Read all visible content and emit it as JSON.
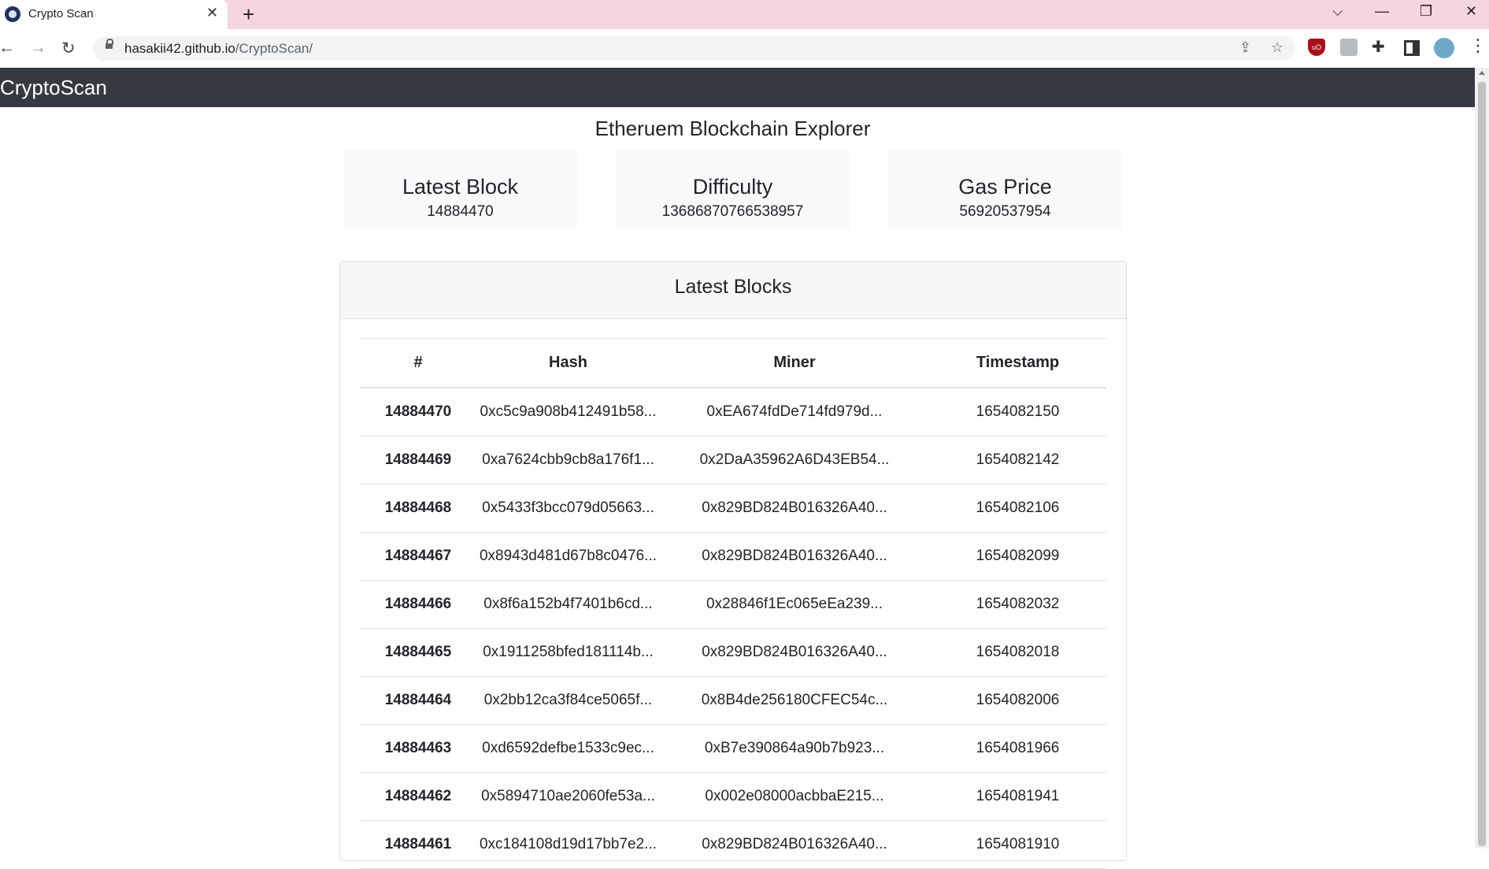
{
  "browser": {
    "tab_title": "Crypto Scan",
    "url_host": "hasakii42.github.io",
    "url_path": "/CryptoScan/"
  },
  "navbar": {
    "brand": "CryptoScan"
  },
  "page": {
    "title": "Etheruem Blockchain Explorer"
  },
  "stats": [
    {
      "label": "Latest Block",
      "value": "14884470"
    },
    {
      "label": "Difficulty",
      "value": "13686870766538957"
    },
    {
      "label": "Gas Price",
      "value": "56920537954"
    }
  ],
  "blocks": {
    "title": "Latest Blocks",
    "columns": [
      "#",
      "Hash",
      "Miner",
      "Timestamp"
    ],
    "rows": [
      {
        "number": "14884470",
        "hash": "0xc5c9a908b412491b58...",
        "miner": "0xEA674fdDe714fd979d...",
        "timestamp": "1654082150"
      },
      {
        "number": "14884469",
        "hash": "0xa7624cbb9cb8a176f1...",
        "miner": "0x2DaA35962A6D43EB54...",
        "timestamp": "1654082142"
      },
      {
        "number": "14884468",
        "hash": "0x5433f3bcc079d05663...",
        "miner": "0x829BD824B016326A40...",
        "timestamp": "1654082106"
      },
      {
        "number": "14884467",
        "hash": "0x8943d481d67b8c0476...",
        "miner": "0x829BD824B016326A40...",
        "timestamp": "1654082099"
      },
      {
        "number": "14884466",
        "hash": "0x8f6a152b4f7401b6cd...",
        "miner": "0x28846f1Ec065eEa239...",
        "timestamp": "1654082032"
      },
      {
        "number": "14884465",
        "hash": "0x1911258bfed181114b...",
        "miner": "0x829BD824B016326A40...",
        "timestamp": "1654082018"
      },
      {
        "number": "14884464",
        "hash": "0x2bb12ca3f84ce5065f...",
        "miner": "0x8B4de256180CFEC54c...",
        "timestamp": "1654082006"
      },
      {
        "number": "14884463",
        "hash": "0xd6592defbe1533c9ec...",
        "miner": "0xB7e390864a90b7b923...",
        "timestamp": "1654081966"
      },
      {
        "number": "14884462",
        "hash": "0x5894710ae2060fe53a...",
        "miner": "0x002e08000acbbaE215...",
        "timestamp": "1654081941"
      },
      {
        "number": "14884461",
        "hash": "0xc184108d19d17bb7e2...",
        "miner": "0x829BD824B016326A40...",
        "timestamp": "1654081910"
      }
    ]
  }
}
